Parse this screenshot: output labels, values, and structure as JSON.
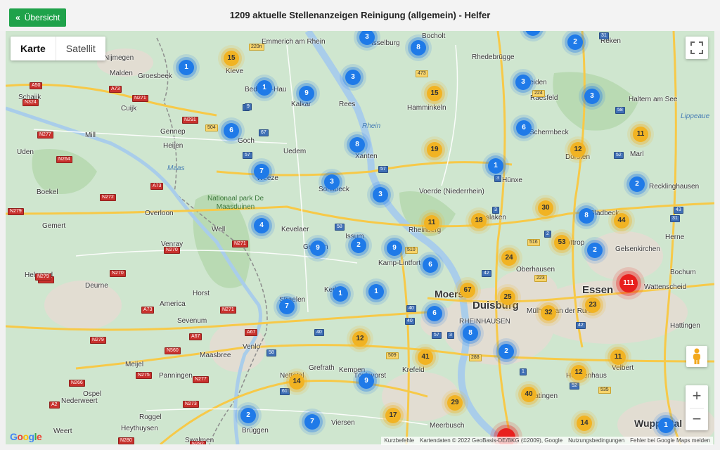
{
  "header": {
    "back_label": "Übersicht",
    "title": "1209 aktuelle Stellenanzeigen Reinigung (allgemein) - Helfer"
  },
  "map_controls": {
    "type_map": "Karte",
    "type_satellite": "Satellit",
    "zoom_in": "+",
    "zoom_out": "−"
  },
  "attribution": {
    "logo": "Google",
    "shortcuts": "Kurzbefehle",
    "data": "Kartendaten © 2022 GeoBasis-DE/BKG (©2009), Google",
    "terms": "Nutzungsbedingungen",
    "report": "Fehler bei Google Maps melden"
  },
  "places": [
    {
      "t": "Nijmegen"
    },
    {
      "t": "Malden"
    },
    {
      "t": "Groesbeek"
    },
    {
      "t": "Kleve"
    },
    {
      "t": "Bedburg-Hau"
    },
    {
      "t": "Schaijk"
    },
    {
      "t": "Cuijk"
    },
    {
      "t": "Kalkar"
    },
    {
      "t": "Rees"
    },
    {
      "t": "Hamminkeln"
    },
    {
      "t": "Gennep"
    },
    {
      "t": "Mill"
    },
    {
      "t": "Heijen"
    },
    {
      "t": "Goch"
    },
    {
      "t": "Uedem"
    },
    {
      "t": "Xanten"
    },
    {
      "t": "Uden"
    },
    {
      "t": "Weeze"
    },
    {
      "t": "Boekel"
    },
    {
      "t": "Sonsbeck"
    },
    {
      "t": "Voerde (Niederrhein)"
    },
    {
      "t": "Overloon"
    },
    {
      "t": "Kevelaer"
    },
    {
      "t": "Gemert"
    },
    {
      "t": "Venray"
    },
    {
      "t": "Well"
    },
    {
      "t": "Issum"
    },
    {
      "t": "Rheinberg"
    },
    {
      "t": "Dinslaken"
    },
    {
      "t": "Geldern"
    },
    {
      "t": "Kamp-Lintfort"
    },
    {
      "t": "Oberhausen"
    },
    {
      "t": "Helmond"
    },
    {
      "t": "Deurne"
    },
    {
      "t": "Horst"
    },
    {
      "t": "Straelen"
    },
    {
      "t": "Kerken"
    },
    {
      "t": "Moers"
    },
    {
      "t": "Duisburg"
    },
    {
      "t": "America"
    },
    {
      "t": "Sevenum"
    },
    {
      "t": "Grefrath"
    },
    {
      "t": "Kempen"
    },
    {
      "t": "Krefeld"
    },
    {
      "t": "Venlo"
    },
    {
      "t": "Maasbree"
    },
    {
      "t": "Meijel"
    },
    {
      "t": "Panningen"
    },
    {
      "t": "Ospel"
    },
    {
      "t": "Nederweert"
    },
    {
      "t": "Roggel"
    },
    {
      "t": "Heythuysen"
    },
    {
      "t": "Weert"
    },
    {
      "t": "Swalmen"
    },
    {
      "t": "Brüggen"
    },
    {
      "t": "Viersen"
    },
    {
      "t": "Meerbusch"
    },
    {
      "t": "Bocholt"
    },
    {
      "t": "Rhedebrügge"
    },
    {
      "t": "Reken"
    },
    {
      "t": "Haltern am See"
    },
    {
      "t": "Schermbeck"
    },
    {
      "t": "Dorsten"
    },
    {
      "t": "Marl"
    },
    {
      "t": "Recklinghausen"
    },
    {
      "t": "Herne"
    },
    {
      "t": "Gelsenkirchen"
    },
    {
      "t": "Gladbeck"
    },
    {
      "t": "Bottrop"
    },
    {
      "t": "Bochum"
    },
    {
      "t": "Essen"
    },
    {
      "t": "Hattingen"
    },
    {
      "t": "Velbert"
    },
    {
      "t": "Wuppertal"
    },
    {
      "t": "Mülheim an der Ruhr"
    },
    {
      "t": "Heiligenhaus"
    },
    {
      "t": "Ratingen"
    },
    {
      "t": "RHEINHAUSEN"
    },
    {
      "t": "Nettetal"
    },
    {
      "t": "Tönisvorst"
    },
    {
      "t": "Hünxe"
    },
    {
      "t": "Raesfeld"
    },
    {
      "t": "Heiden"
    },
    {
      "t": "Emmerich am Rhein"
    },
    {
      "t": "Rhein"
    },
    {
      "t": "Maas"
    },
    {
      "t": "Lippeaue"
    },
    {
      "t": "Nationaal park De Maasduinen"
    },
    {
      "t": "Wattenscheid"
    },
    {
      "t": "Isselburg"
    }
  ],
  "roads": [
    {
      "t": "A50"
    },
    {
      "t": "N324"
    },
    {
      "t": "A73"
    },
    {
      "t": "N271"
    },
    {
      "t": "N277"
    },
    {
      "t": "N264"
    },
    {
      "t": "A73"
    },
    {
      "t": "N272"
    },
    {
      "t": "N279"
    },
    {
      "t": "N270"
    },
    {
      "t": "N271"
    },
    {
      "t": "N277"
    },
    {
      "t": "N279"
    },
    {
      "t": "N270"
    },
    {
      "t": "A73"
    },
    {
      "t": "N271"
    },
    {
      "t": "A67"
    },
    {
      "t": "A67"
    },
    {
      "t": "N279"
    },
    {
      "t": "N560"
    },
    {
      "t": "N275"
    },
    {
      "t": "N277"
    },
    {
      "t": "N266"
    },
    {
      "t": "A2"
    },
    {
      "t": "N273"
    },
    {
      "t": "N280"
    },
    {
      "t": "N292"
    },
    {
      "t": "220n"
    },
    {
      "t": "504"
    },
    {
      "t": "57"
    },
    {
      "t": "N291"
    },
    {
      "t": "9"
    },
    {
      "t": "67"
    },
    {
      "t": "473"
    },
    {
      "t": "58"
    },
    {
      "t": "57"
    },
    {
      "t": "3"
    },
    {
      "t": "3"
    },
    {
      "t": "40"
    },
    {
      "t": "40"
    },
    {
      "t": "42"
    },
    {
      "t": "42"
    },
    {
      "t": "52"
    },
    {
      "t": "43"
    },
    {
      "t": "2"
    },
    {
      "t": "31"
    },
    {
      "t": "31"
    },
    {
      "t": "224"
    },
    {
      "t": "58"
    },
    {
      "t": "516"
    },
    {
      "t": "223"
    },
    {
      "t": "57"
    },
    {
      "t": "288"
    },
    {
      "t": "509"
    },
    {
      "t": "61"
    },
    {
      "t": "52"
    },
    {
      "t": "535"
    },
    {
      "t": "1"
    },
    {
      "t": "40"
    },
    {
      "t": "3"
    },
    {
      "t": "9"
    },
    {
      "t": "58"
    },
    {
      "t": "510"
    }
  ],
  "clusters": [
    {
      "n": "15",
      "c": "yellow"
    },
    {
      "n": "1",
      "c": "blue"
    },
    {
      "n": "1",
      "c": "blue"
    },
    {
      "n": "9",
      "c": "blue"
    },
    {
      "n": "3",
      "c": "blue"
    },
    {
      "n": "8",
      "c": "blue"
    },
    {
      "n": "3",
      "c": "blue"
    },
    {
      "n": "15",
      "c": "yellow"
    },
    {
      "n": "3",
      "c": "blue"
    },
    {
      "n": "2",
      "c": "blue"
    },
    {
      "n": "3",
      "c": "blue"
    },
    {
      "n": "6",
      "c": "blue"
    },
    {
      "n": "8",
      "c": "blue"
    },
    {
      "n": "19",
      "c": "yellow"
    },
    {
      "n": "6",
      "c": "blue"
    },
    {
      "n": "12",
      "c": "yellow"
    },
    {
      "n": "11",
      "c": "yellow"
    },
    {
      "n": "1",
      "c": "blue"
    },
    {
      "n": "7",
      "c": "blue"
    },
    {
      "n": "3",
      "c": "blue"
    },
    {
      "n": "3",
      "c": "blue"
    },
    {
      "n": "2",
      "c": "blue"
    },
    {
      "n": "4",
      "c": "blue"
    },
    {
      "n": "11",
      "c": "yellow"
    },
    {
      "n": "18",
      "c": "yellow"
    },
    {
      "n": "30",
      "c": "yellow"
    },
    {
      "n": "8",
      "c": "blue"
    },
    {
      "n": "44",
      "c": "yellow"
    },
    {
      "n": "9",
      "c": "blue"
    },
    {
      "n": "2",
      "c": "blue"
    },
    {
      "n": "9",
      "c": "blue"
    },
    {
      "n": "6",
      "c": "blue"
    },
    {
      "n": "53",
      "c": "yellow"
    },
    {
      "n": "2",
      "c": "blue"
    },
    {
      "n": "24",
      "c": "yellow"
    },
    {
      "n": "111",
      "c": "red"
    },
    {
      "n": "1",
      "c": "blue"
    },
    {
      "n": "1",
      "c": "blue"
    },
    {
      "n": "67",
      "c": "yellow"
    },
    {
      "n": "25",
      "c": "yellow"
    },
    {
      "n": "7",
      "c": "blue"
    },
    {
      "n": "6",
      "c": "blue"
    },
    {
      "n": "32",
      "c": "yellow"
    },
    {
      "n": "23",
      "c": "yellow"
    },
    {
      "n": "8",
      "c": "blue"
    },
    {
      "n": "12",
      "c": "yellow"
    },
    {
      "n": "41",
      "c": "yellow"
    },
    {
      "n": "2",
      "c": "blue"
    },
    {
      "n": "11",
      "c": "yellow"
    },
    {
      "n": "14",
      "c": "yellow"
    },
    {
      "n": "9",
      "c": "blue"
    },
    {
      "n": "12",
      "c": "yellow"
    },
    {
      "n": "40",
      "c": "yellow"
    },
    {
      "n": "2",
      "c": "blue"
    },
    {
      "n": "17",
      "c": "yellow"
    },
    {
      "n": "29",
      "c": "yellow"
    },
    {
      "n": "7",
      "c": "blue"
    },
    {
      "n": "14",
      "c": "yellow"
    },
    {
      "n": "1",
      "c": "blue"
    },
    {
      "n": "2",
      "c": "blue"
    },
    {
      "n": "",
      "c": "red"
    }
  ],
  "colors": {
    "land": "#cfe6cf",
    "water": "#a9cdea",
    "urban": "#e6e1d8",
    "motorway": "#f7c948",
    "back_button": "#1fa24a"
  }
}
